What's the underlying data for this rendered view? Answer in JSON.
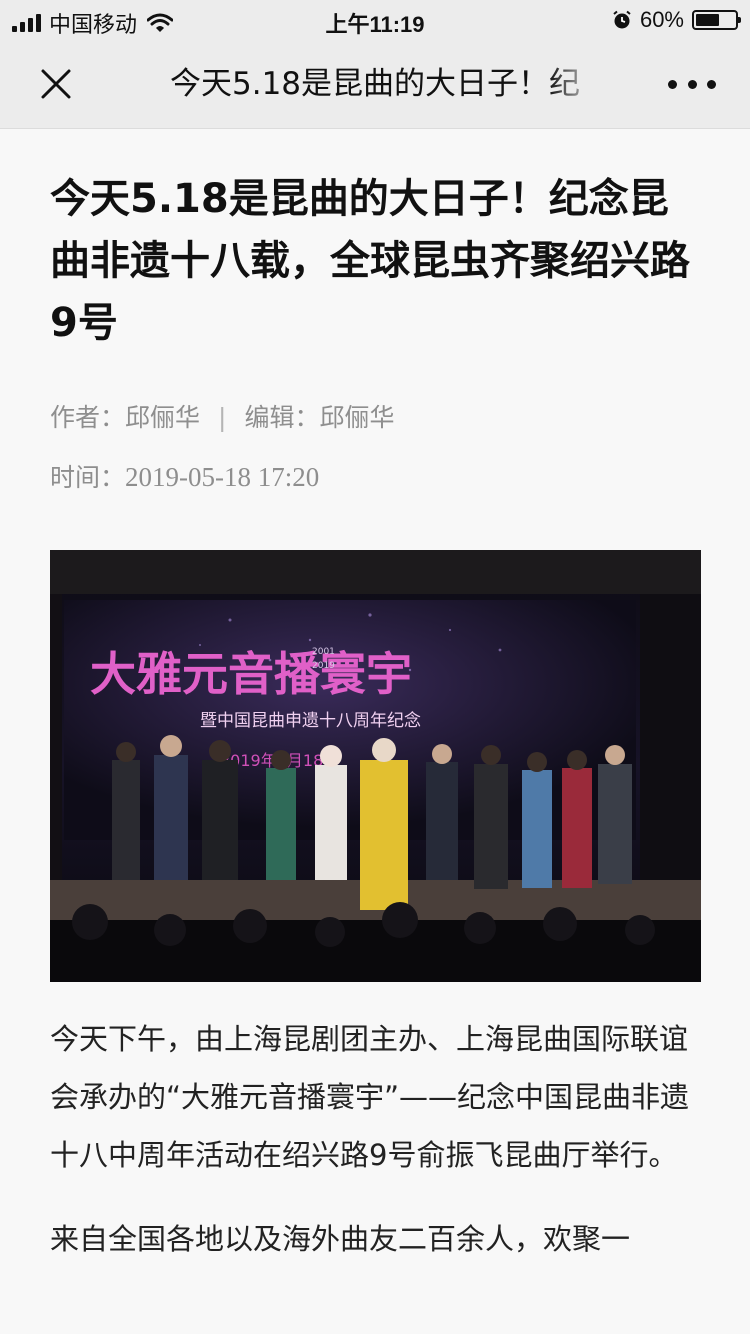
{
  "status_bar": {
    "carrier": "中国移动",
    "time": "上午11:19",
    "battery_text": "60%",
    "battery_level": 0.6,
    "icons": [
      "signal-icon",
      "wifi-icon",
      "alarm-icon",
      "battery-icon"
    ]
  },
  "navbar": {
    "title": "今天5.18是昆曲的大日子！纪",
    "icons": [
      "close-icon",
      "more-icon"
    ]
  },
  "article": {
    "title": "今天5.18是昆曲的大日子！纪念昆曲非遗十八载，全球昆虫齐聚绍兴路9号",
    "author_label": "作者：",
    "author": "邱俪华",
    "editor_label": "编辑：",
    "editor": "邱俪华",
    "time_label": "时间：",
    "time": "2019-05-18 17:20",
    "photo": {
      "banner_title": "大雅元音播寰宇",
      "banner_years_top": "2001",
      "banner_years_bottom": "2019",
      "banner_subtitle": "暨中国昆曲申遗十八周年纪念",
      "banner_date": "2019年5月18日"
    },
    "paragraphs": [
      "今天下午，由上海昆剧团主办、上海昆曲国际联谊会承办的“大雅元音播寰宇”——纪念中国昆曲非遗十八中周年活动在绍兴路9号俞振飞昆曲厅举行。",
      "来自全国各地以及海外曲友二百余人，欢聚一"
    ]
  },
  "colors": {
    "bar_bg": "#ececec",
    "page_bg": "#f8f8f8",
    "meta_gray": "#8e8e8e",
    "banner_pink": "#e060c8"
  }
}
